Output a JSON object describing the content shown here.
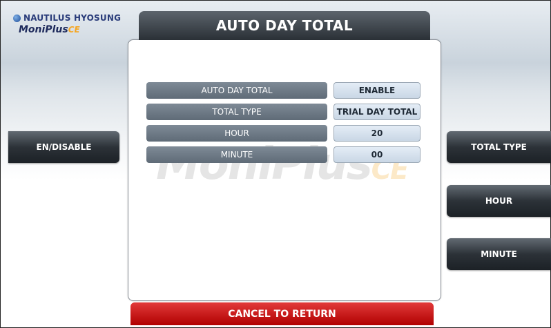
{
  "brand": {
    "company": "NAUTILUS HYOSUNG",
    "product": "MoniPlus",
    "product_suffix": "CE"
  },
  "screen": {
    "title": "AUTO DAY TOTAL"
  },
  "settings": [
    {
      "label": "AUTO DAY TOTAL",
      "value": "ENABLE"
    },
    {
      "label": "TOTAL TYPE",
      "value": "TRIAL DAY TOTAL"
    },
    {
      "label": "HOUR",
      "value": "20"
    },
    {
      "label": "MINUTE",
      "value": "00"
    }
  ],
  "left_buttons": [
    {
      "label": "EN/DISABLE"
    }
  ],
  "right_buttons": [
    {
      "label": "TOTAL TYPE"
    },
    {
      "label": "HOUR"
    },
    {
      "label": "MINUTE"
    }
  ],
  "footer": {
    "cancel_label": "CANCEL TO RETURN"
  },
  "colors": {
    "button_dark": "#2c3238",
    "cancel_red": "#c40000",
    "label_bg": "#6f7b87",
    "value_bg": "#d6e2ee"
  }
}
